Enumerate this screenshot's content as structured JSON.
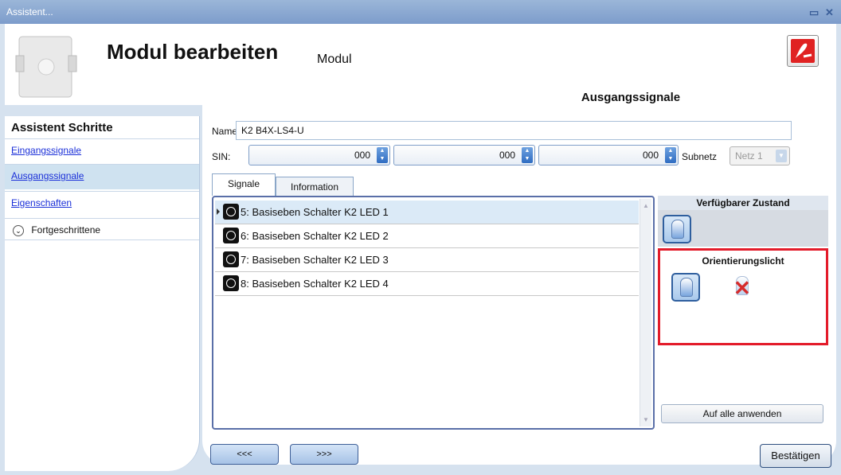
{
  "window": {
    "title": "Assistent...",
    "controls": [
      "restore-icon",
      "close-icon"
    ]
  },
  "header": {
    "title": "Modul bearbeiten",
    "subtitle": "Modul",
    "section": "Ausgangssignale",
    "pdf_icon": "pdf-icon"
  },
  "sidebar": {
    "title": "Assistent Schritte",
    "items": [
      {
        "label": "Eingangssignale",
        "active": false
      },
      {
        "label": "Ausgangssignale",
        "active": true
      },
      {
        "label": "Eigenschaften",
        "active": false
      }
    ],
    "advanced_label": "Fortgeschrittene"
  },
  "form": {
    "name_label": "Name",
    "name_value": "K2 B4X-LS4-U",
    "sin_label": "SIN:",
    "sin_values": [
      "000",
      "000",
      "000"
    ],
    "subnet_label": "Subnetz",
    "subnet_value": "Netz 1"
  },
  "tabs": [
    {
      "label": "Signale",
      "active": true
    },
    {
      "label": "Information",
      "active": false
    }
  ],
  "signals": [
    "5: Basiseben Schalter K2 LED 1",
    "6: Basiseben Schalter K2 LED 2",
    "7: Basiseben Schalter K2 LED 3",
    "8: Basiseben Schalter K2 LED 4"
  ],
  "right_panel": {
    "available_title": "Verfügbarer Zustand",
    "orientation_title": "Orientierungslicht",
    "apply_all_label": "Auf alle anwenden"
  },
  "nav": {
    "back_label": "<<<",
    "next_label": ">>>",
    "confirm_label": "Bestätigen"
  },
  "colors": {
    "highlight_border": "#e31b2a",
    "link": "#1a2fd8",
    "title_bar": "#7d9ccb"
  }
}
